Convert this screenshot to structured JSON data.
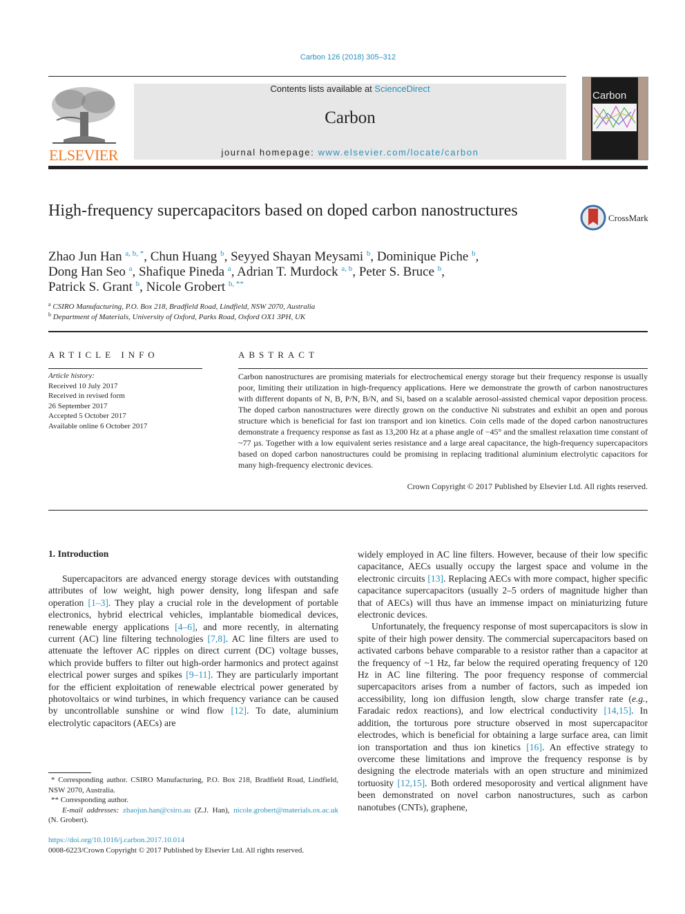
{
  "header": {
    "citation": "Carbon 126 (2018) 305–312",
    "contents_prefix": "Contents lists available at ",
    "contents_link": "ScienceDirect",
    "journal_name": "Carbon",
    "homepage_prefix": "journal homepage: ",
    "homepage_link": "www.elsevier.com/locate/carbon",
    "publisher_logo": "ELSEVIER",
    "cover_title": "Carbon"
  },
  "article": {
    "title": "High-frequency supercapacitors based on doped carbon nanostructures",
    "crossmark_label": "CrossMark",
    "authors": [
      {
        "name": "Zhao Jun Han",
        "sup": "a, b, *",
        "sep": ", "
      },
      {
        "name": "Chun Huang",
        "sup": "b",
        "sep": ", "
      },
      {
        "name": "Seyyed Shayan Meysami",
        "sup": "b",
        "sep": ", "
      },
      {
        "name": "Dominique Piche",
        "sup": "b",
        "sep": ","
      },
      {
        "name": "Dong Han Seo",
        "sup": "a",
        "sep": ", "
      },
      {
        "name": "Shafique Pineda",
        "sup": "a",
        "sep": ", "
      },
      {
        "name": "Adrian T. Murdock",
        "sup": "a, b",
        "sep": ", "
      },
      {
        "name": "Peter S. Bruce",
        "sup": "b",
        "sep": ","
      },
      {
        "name": "Patrick S. Grant",
        "sup": "b",
        "sep": ", "
      },
      {
        "name": "Nicole Grobert",
        "sup": "b, **",
        "sep": ""
      }
    ],
    "affiliations": [
      {
        "key": "a",
        "text": "CSIRO Manufacturing, P.O. Box 218, Bradfield Road, Lindfield, NSW 2070, Australia"
      },
      {
        "key": "b",
        "text": "Department of Materials, University of Oxford, Parks Road, Oxford OX1 3PH, UK"
      }
    ]
  },
  "article_info": {
    "heading": "ARTICLE INFO",
    "history_label": "Article history:",
    "history": [
      "Received 10 July 2017",
      "Received in revised form",
      "26 September 2017",
      "Accepted 5 October 2017",
      "Available online 6 October 2017"
    ]
  },
  "abstract": {
    "heading": "ABSTRACT",
    "text": "Carbon nanostructures are promising materials for electrochemical energy storage but their frequency response is usually poor, limiting their utilization in high-frequency applications. Here we demonstrate the growth of carbon nanostructures with different dopants of N, B, P/N, B/N, and Si, based on a scalable aerosol-assisted chemical vapor deposition process. The doped carbon nanostructures were directly grown on the conductive Ni substrates and exhibit an open and porous structure which is beneficial for fast ion transport and ion kinetics. Coin cells made of the doped carbon nanostructures demonstrate a frequency response as fast as 13,200 Hz at a phase angle of −45° and the smallest relaxation time constant of ~77 µs. Together with a low equivalent series resistance and a large areal capacitance, the high-frequency supercapacitors based on doped carbon nanostructures could be promising in replacing traditional aluminium electrolytic capacitors for many high-frequency electronic devices.",
    "copyright": "Crown Copyright © 2017 Published by Elsevier Ltd. All rights reserved."
  },
  "body": {
    "section_heading": "1.  Introduction",
    "left_paragraphs": [
      [
        {
          "t": "Supercapacitors are advanced energy storage devices with outstanding attributes of low weight, high power density, long lifespan and safe operation "
        },
        {
          "ref": "[1–3]"
        },
        {
          "t": ". They play a crucial role in the development of portable electronics, hybrid electrical vehicles, implantable biomedical devices, renewable energy applications "
        },
        {
          "ref": "[4–6]"
        },
        {
          "t": ", and more recently, in alternating current (AC) line filtering technologies "
        },
        {
          "ref": "[7,8]"
        },
        {
          "t": ". AC line filters are used to attenuate the leftover AC ripples on direct current (DC) voltage busses, which provide buffers to filter out high-order harmonics and protect against electrical power surges and spikes "
        },
        {
          "ref": "[9–11]"
        },
        {
          "t": ". They are particularly important for the efficient exploitation of renewable electrical power generated by photovoltaics or wind turbines, in which frequency variance can be caused by uncontrollable sunshine or wind flow "
        },
        {
          "ref": "[12]"
        },
        {
          "t": ". To date, aluminium electrolytic capacitors (AECs) are"
        }
      ]
    ],
    "right_paragraphs": [
      [
        {
          "t": "widely employed in AC line filters. However, because of their low specific capacitance, AECs usually occupy the largest space and volume in the electronic circuits "
        },
        {
          "ref": "[13]"
        },
        {
          "t": ". Replacing AECs with more compact, higher specific capacitance supercapacitors (usually 2–5 orders of magnitude higher than that of AECs) will thus have an immense impact on miniaturizing future electronic devices."
        }
      ],
      [
        {
          "t": "Unfortunately, the frequency response of most supercapacitors is slow in spite of their high power density. The commercial supercapacitors based on activated carbons behave comparable to a resistor rather than a capacitor at the frequency of ~1 Hz, far below the required operating frequency of 120 Hz in AC line filtering. The poor frequency response of commercial supercapacitors arises from a number of factors, such as impeded ion accessibility, long ion diffusion length, slow charge transfer rate ("
        },
        {
          "i": "e.g."
        },
        {
          "t": ", Faradaic redox reactions), and low electrical conductivity "
        },
        {
          "ref": "[14,15]"
        },
        {
          "t": ". In addition, the torturous pore structure observed in most supercapacitor electrodes, which is beneficial for obtaining a large surface area, can limit ion transportation and thus ion kinetics "
        },
        {
          "ref": "[16]"
        },
        {
          "t": ". An effective strategy to overcome these limitations and improve the frequency response is by designing the electrode materials with an open structure and minimized tortuosity "
        },
        {
          "ref": "[12,15]"
        },
        {
          "t": ". Both ordered mesoporosity and vertical alignment have been demonstrated on novel carbon nanostructures, such as carbon nanotubes (CNTs), graphene,"
        }
      ]
    ]
  },
  "footnotes": {
    "corresponding_1": " * Corresponding author. CSIRO Manufacturing, P.O. Box 218, Bradfield Road, Lindfield, NSW 2070, Australia.",
    "corresponding_2": "** Corresponding author.",
    "email_label": "E-mail addresses: ",
    "email_1": "zhaojun.han@csiro.au",
    "email_1_owner": " (Z.J. Han), ",
    "email_2": "nicole.grobert@materials.ox.ac.uk",
    "email_2_owner": " (N. Grobert).",
    "doi": "https://doi.org/10.1016/j.carbon.2017.10.014",
    "issn_copyright": "0008-6223/Crown Copyright © 2017 Published by Elsevier Ltd. All rights reserved."
  },
  "colors": {
    "link": "#2a8fbd",
    "elsevier_orange": "#f47920",
    "masthead_gray": "#e7e7e7",
    "text": "#231f20"
  }
}
